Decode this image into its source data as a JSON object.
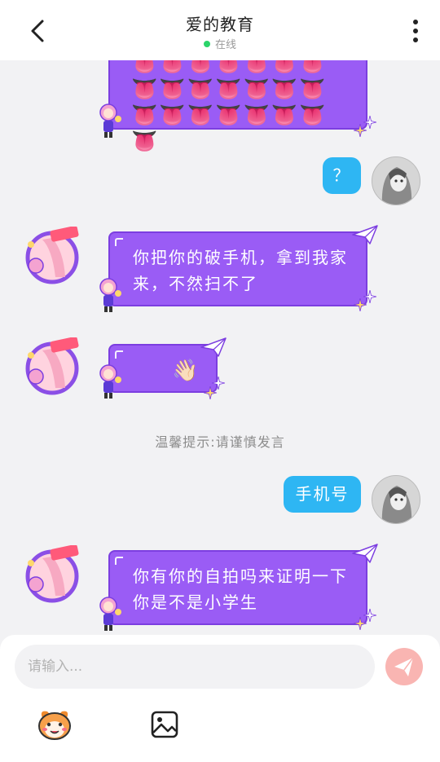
{
  "header": {
    "title": "爱的教育",
    "status": "在线"
  },
  "messages": [
    {
      "side": "left",
      "type": "emoji-grid",
      "text": "👅👅👅👅👅👅👅👅"
    },
    {
      "side": "right",
      "type": "text",
      "text": "？"
    },
    {
      "side": "left",
      "type": "text",
      "text": "你把你的破手机，拿到我家来，不然扫不了"
    },
    {
      "side": "left",
      "type": "emoji",
      "text": "👋🏻"
    },
    {
      "side": "right",
      "type": "text",
      "text": "手机号"
    },
    {
      "side": "left",
      "type": "text",
      "text": "你有你的自拍吗来证明一下你是不是小学生"
    }
  ],
  "notice": "温馨提示:请谨慎发言",
  "composer": {
    "placeholder": "请输入..."
  },
  "colors": {
    "purple_bubble": "#9a5cf5",
    "blue_bubble": "#2eb6f3",
    "online_dot": "#2bd46a",
    "send_button": "#f9b5b2"
  },
  "icons": [
    "back-arrow-icon",
    "more-vertical-icon",
    "paper-plane-icon",
    "send-icon",
    "emoji-face-icon",
    "image-icon"
  ]
}
